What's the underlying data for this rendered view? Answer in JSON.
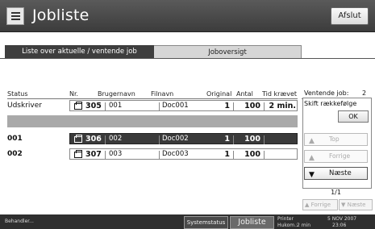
{
  "header": {
    "title": "Jobliste",
    "close_label": "Afslut"
  },
  "tabs": [
    {
      "label": "Liste over aktuelle / ventende job"
    },
    {
      "label": "Joboversigt"
    }
  ],
  "columns": {
    "status": "Status",
    "nr": "Nr.",
    "user": "Brugernavn",
    "file": "Filnavn",
    "original": "Original",
    "antal": "Antal",
    "tid": "Tid krævet"
  },
  "current_job": {
    "status": "Udskriver",
    "nr": "305",
    "user": "001",
    "file": "Doc001",
    "original": "1",
    "antal": "100",
    "tid": "2 min."
  },
  "queue": [
    {
      "status": "001",
      "nr": "306",
      "user": "002",
      "file": "Doc002",
      "original": "1",
      "antal": "100"
    },
    {
      "status": "002",
      "nr": "307",
      "user": "003",
      "file": "Doc003",
      "original": "1",
      "antal": "100"
    }
  ],
  "panel": {
    "waiting_label": "Ventende job:",
    "waiting_count": "2",
    "change_order": "Skift rækkefølge",
    "ok": "OK",
    "top": "Top",
    "previous": "Forrige",
    "next": "Næste",
    "page": "1/1",
    "page_prev": "Forrige",
    "page_next": "Næste"
  },
  "footer": {
    "status": "Behandler...",
    "system_status": "Systemstatus",
    "job_list": "Jobliste",
    "printer_label": "Printer",
    "date": "5 NOV 2007",
    "memory_label": "Hukom.:",
    "memory_value": "2 min",
    "time": "23:06"
  }
}
